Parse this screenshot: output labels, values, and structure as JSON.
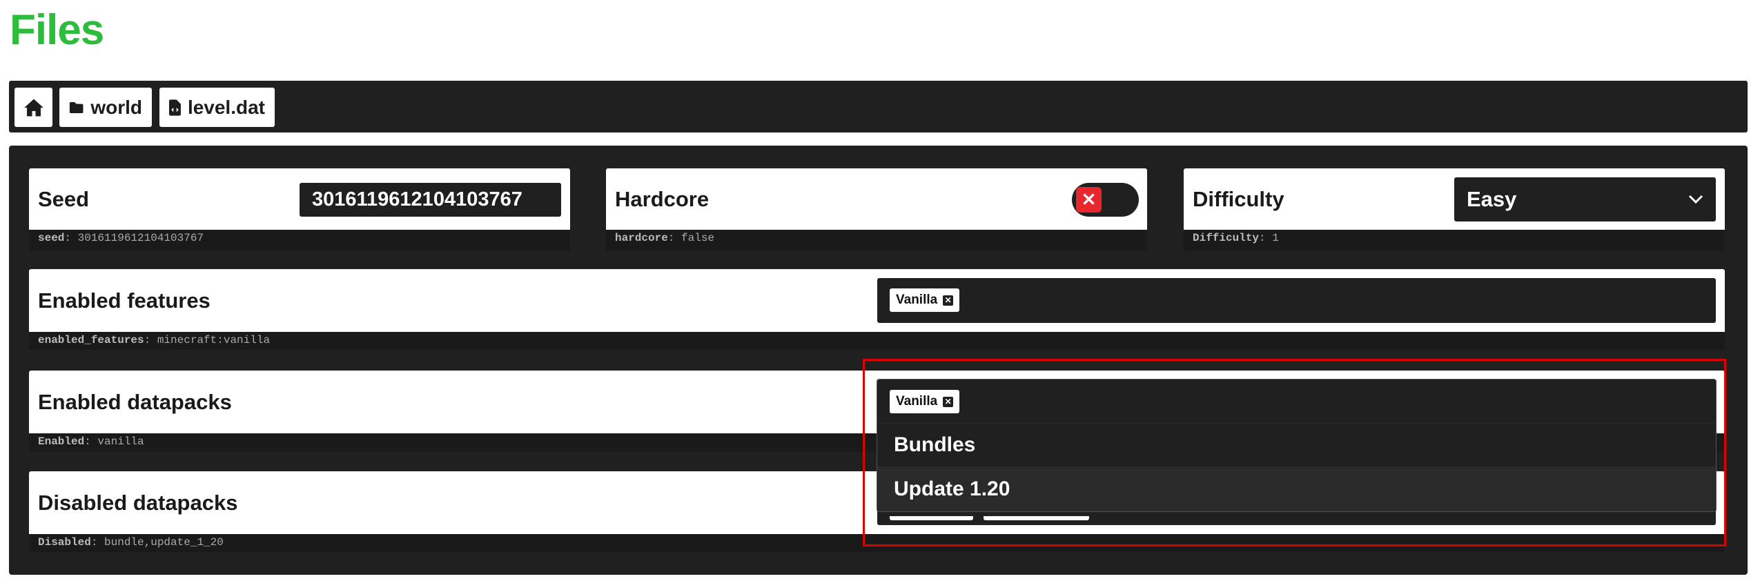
{
  "title": "Files",
  "breadcrumb": {
    "items": [
      {
        "label": "",
        "icon": "home-icon"
      },
      {
        "label": "world",
        "icon": "folder-icon"
      },
      {
        "label": "level.dat",
        "icon": "code-file-icon"
      }
    ]
  },
  "fields": {
    "seed": {
      "label": "Seed",
      "value": "3016119612104103767",
      "key": "seed",
      "raw": "3016119612104103767"
    },
    "hardcore": {
      "label": "Hardcore",
      "checked": false,
      "key": "hardcore",
      "raw": "false"
    },
    "difficulty": {
      "label": "Difficulty",
      "value": "Easy",
      "key": "Difficulty",
      "raw": "1"
    },
    "enabled_features": {
      "label": "Enabled features",
      "tags": [
        "Vanilla"
      ],
      "key": "enabled_features",
      "raw": "minecraft:vanilla"
    },
    "enabled_datapacks": {
      "label": "Enabled datapacks",
      "tags": [
        "Vanilla"
      ],
      "key": "Enabled",
      "raw": "vanilla"
    },
    "disabled_datapacks": {
      "label": "Disabled datapacks",
      "key": "Disabled",
      "raw": "bundle,update_1_20"
    }
  },
  "dropdown": {
    "options": [
      "Bundles",
      "Update 1.20"
    ],
    "highlighted": "Update 1.20"
  },
  "colors": {
    "accent": "#2dbd3c",
    "dark": "#202020",
    "toggle_off": "#e8262e",
    "highlight": "#ff0000"
  }
}
